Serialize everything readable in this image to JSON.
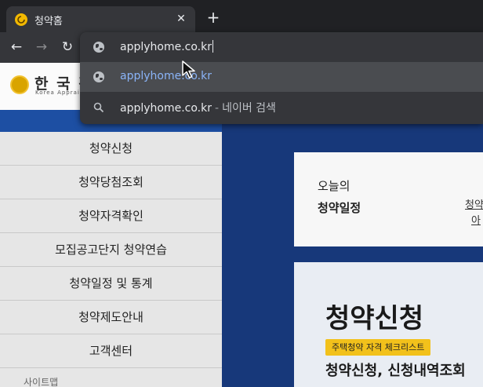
{
  "browser": {
    "tab": {
      "title": "청약홈",
      "close_glyph": "✕"
    },
    "new_tab_glyph": "+",
    "nav": {
      "back_glyph": "←",
      "forward_glyph": "→",
      "reload_glyph": "↻"
    },
    "omnibox": {
      "input_value": "applyhome.co.kr",
      "suggestions": [
        {
          "icon": "globe-icon",
          "text": "applyhome.co.kr"
        },
        {
          "icon": "search-icon",
          "text": "applyhome.co.kr",
          "separator": "-",
          "suffix": "네이버 검색"
        }
      ]
    }
  },
  "site": {
    "logo": {
      "text": "한 국 감",
      "subtitle": "Korea Apprai"
    },
    "menu": [
      "청약신청",
      "청약당첨조회",
      "청약자격확인",
      "모집공고단지 청약연습",
      "청약일정 및 통계",
      "청약제도안내",
      "고객센터"
    ],
    "menu_more": "사이트맵",
    "today": {
      "line1": "오늘의",
      "line2": "청약일정",
      "link1": "청약",
      "link2": "아"
    },
    "apply": {
      "title": "청약신청",
      "badge": "주택청약 자격 체크리스트",
      "subtitle": "청약신청, 신청내역조회"
    }
  },
  "colors": {
    "chrome_bg": "#202124",
    "toolbar_bg": "#35363a",
    "selected_row": "#4a4c50",
    "link_blue": "#8ab4f8",
    "site_blue": "#17387a",
    "badge_yellow": "#f2c11b"
  }
}
